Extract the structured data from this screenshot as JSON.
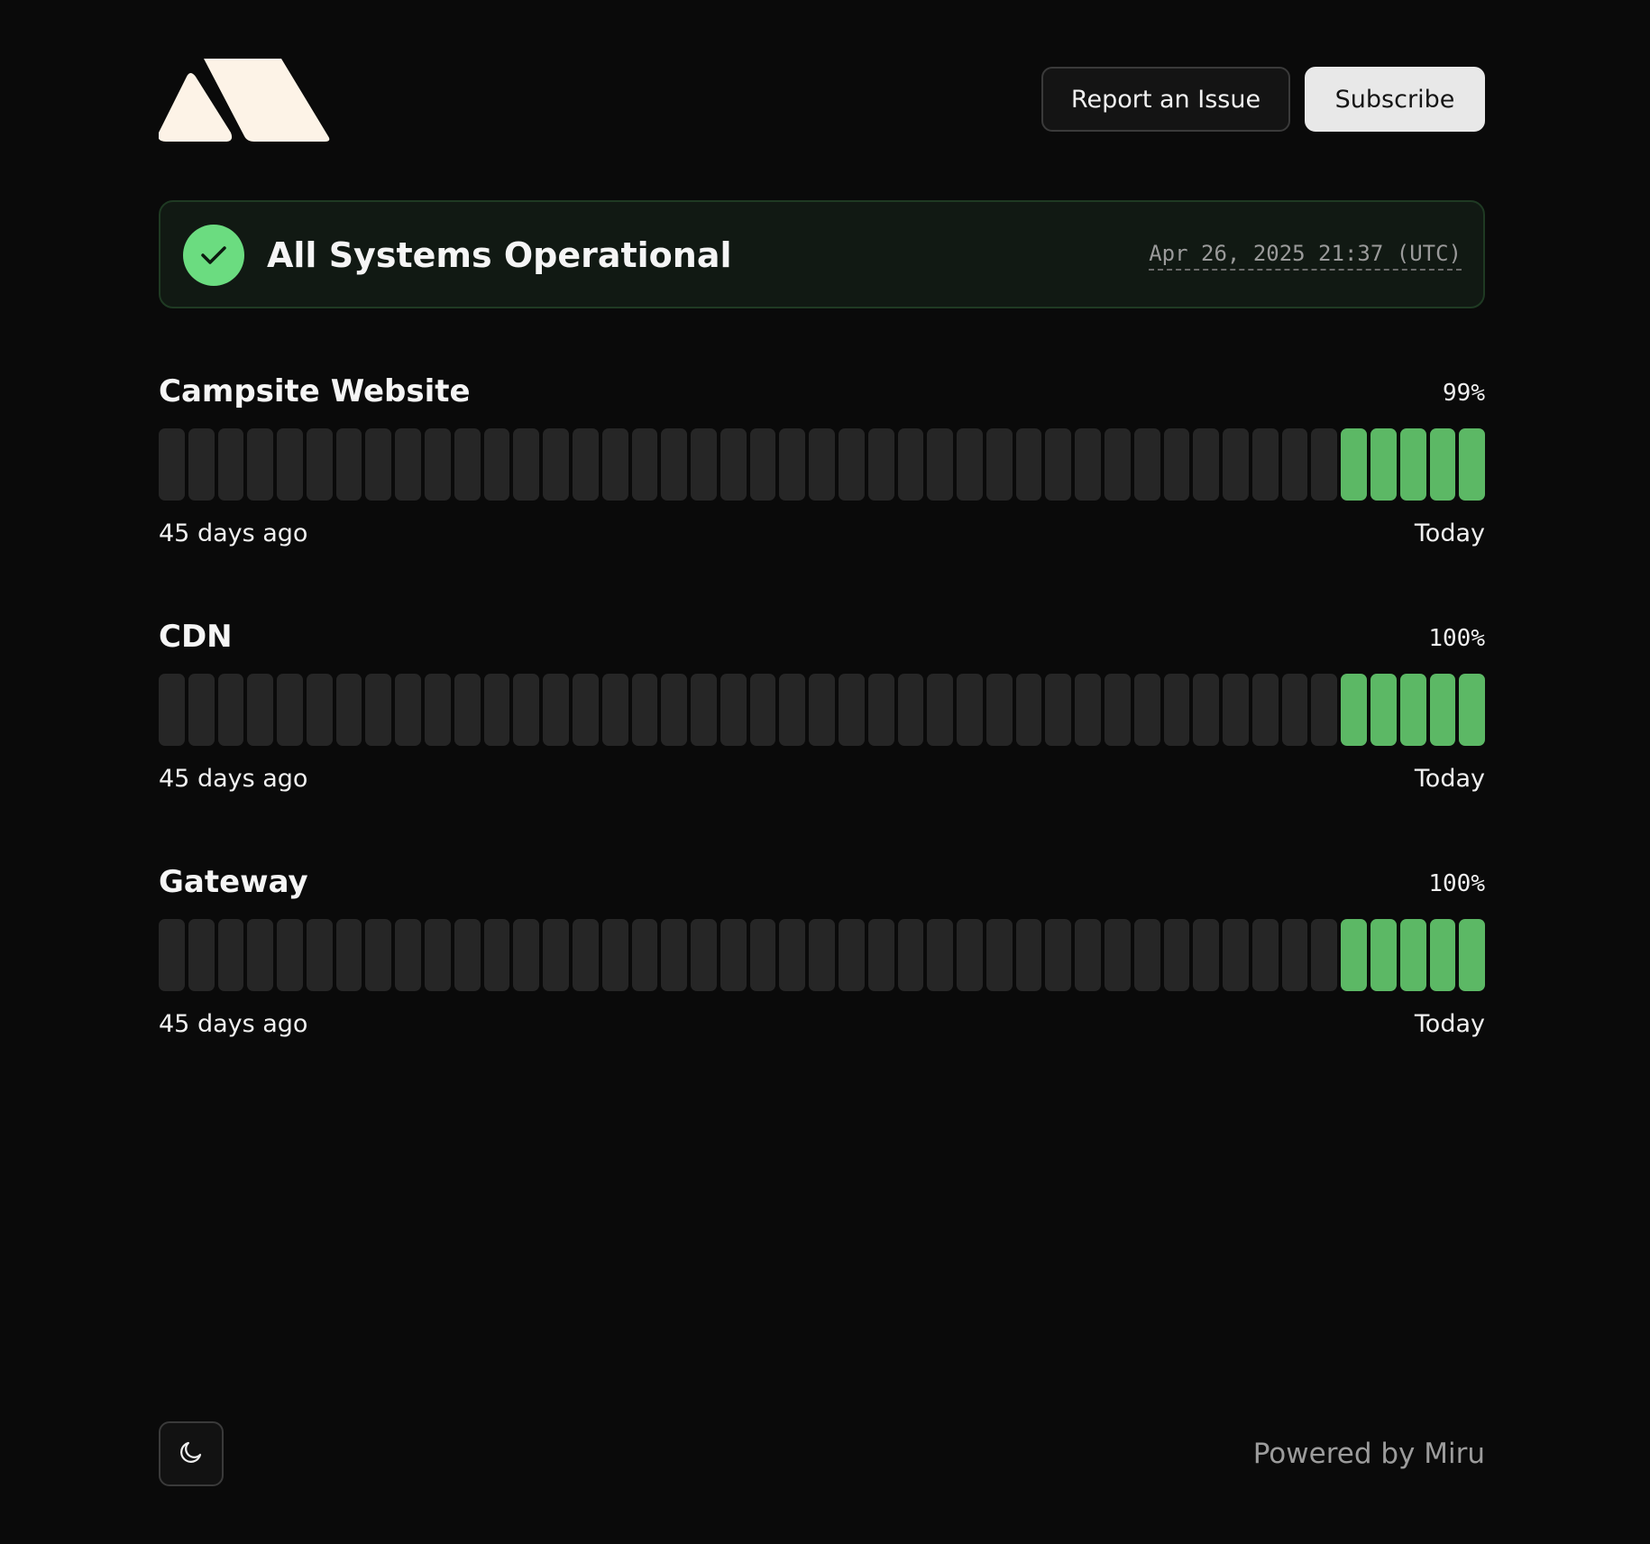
{
  "header": {
    "logo_icon": "campsite-logo-icon",
    "report_label": "Report an Issue",
    "subscribe_label": "Subscribe"
  },
  "status": {
    "icon": "check-icon",
    "title": "All Systems Operational",
    "timestamp": "Apr 26, 2025 21:37 (UTC)",
    "color": "#6bdc80"
  },
  "colors": {
    "operational": "#5cb865",
    "no_data": "#262626",
    "background": "#0a0a0a"
  },
  "services": [
    {
      "name": "Campsite Website",
      "uptime": "99%",
      "range_start": "45 days ago",
      "range_end": "Today",
      "days": [
        "none",
        "none",
        "none",
        "none",
        "none",
        "none",
        "none",
        "none",
        "none",
        "none",
        "none",
        "none",
        "none",
        "none",
        "none",
        "none",
        "none",
        "none",
        "none",
        "none",
        "none",
        "none",
        "none",
        "none",
        "none",
        "none",
        "none",
        "none",
        "none",
        "none",
        "none",
        "none",
        "none",
        "none",
        "none",
        "none",
        "none",
        "none",
        "none",
        "none",
        "ok",
        "ok",
        "ok",
        "ok",
        "ok"
      ]
    },
    {
      "name": "CDN",
      "uptime": "100%",
      "range_start": "45 days ago",
      "range_end": "Today",
      "days": [
        "none",
        "none",
        "none",
        "none",
        "none",
        "none",
        "none",
        "none",
        "none",
        "none",
        "none",
        "none",
        "none",
        "none",
        "none",
        "none",
        "none",
        "none",
        "none",
        "none",
        "none",
        "none",
        "none",
        "none",
        "none",
        "none",
        "none",
        "none",
        "none",
        "none",
        "none",
        "none",
        "none",
        "none",
        "none",
        "none",
        "none",
        "none",
        "none",
        "none",
        "ok",
        "ok",
        "ok",
        "ok",
        "ok"
      ]
    },
    {
      "name": "Gateway",
      "uptime": "100%",
      "range_start": "45 days ago",
      "range_end": "Today",
      "days": [
        "none",
        "none",
        "none",
        "none",
        "none",
        "none",
        "none",
        "none",
        "none",
        "none",
        "none",
        "none",
        "none",
        "none",
        "none",
        "none",
        "none",
        "none",
        "none",
        "none",
        "none",
        "none",
        "none",
        "none",
        "none",
        "none",
        "none",
        "none",
        "none",
        "none",
        "none",
        "none",
        "none",
        "none",
        "none",
        "none",
        "none",
        "none",
        "none",
        "none",
        "ok",
        "ok",
        "ok",
        "ok",
        "ok"
      ]
    }
  ],
  "footer": {
    "theme_icon": "moon-icon",
    "powered_by": "Powered by Miru"
  }
}
